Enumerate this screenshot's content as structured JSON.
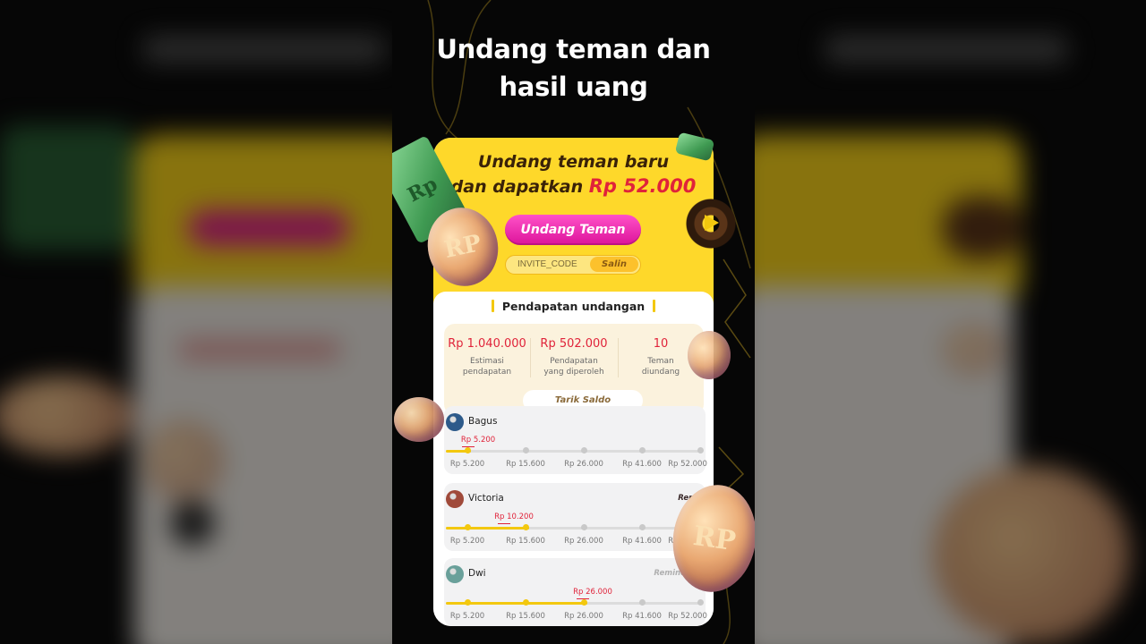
{
  "headline": [
    "Undang teman dan",
    "hasil uang"
  ],
  "promo": {
    "line1": "Undang teman baru",
    "line2_prefix": "dan dapatkan",
    "line2_amount": "Rp 52.000"
  },
  "invite_button": "Undang Teman",
  "invite_code": {
    "value": "INVITE_CODE",
    "copy_label": "Salin"
  },
  "earnings": {
    "title": "Pendapatan undangan",
    "stats": [
      {
        "value": "Rp 1.040.000",
        "label": [
          "Estimasi",
          "pendapatan"
        ]
      },
      {
        "value": "Rp 502.000",
        "label": [
          "Pendapatan",
          "yang diperoleh"
        ]
      },
      {
        "value": "10",
        "label": [
          "Teman",
          "diundang"
        ]
      }
    ],
    "withdraw_label": "Tarik Saldo"
  },
  "milestones": [
    "Rp 5.200",
    "Rp 15.600",
    "Rp 26.000",
    "Rp 41.600",
    "Rp 52.000"
  ],
  "friends": [
    {
      "name": "Bagus",
      "current": "Rp 5.200",
      "progress_step": 0,
      "tag": ""
    },
    {
      "name": "Victoria",
      "current": "Rp 10.200",
      "progress_step": 1,
      "tag": "Rem"
    },
    {
      "name": "Dwi",
      "current": "Rp 26.000",
      "progress_step": 2,
      "tag": "Reminded"
    }
  ],
  "colors": {
    "accent_yellow": "#fed82a",
    "pink_button": "#e0239a",
    "price_red": "#e0233a",
    "background": "#060606"
  },
  "decor": {
    "coin_glyph": "RP",
    "money_glyph": "Rp"
  }
}
